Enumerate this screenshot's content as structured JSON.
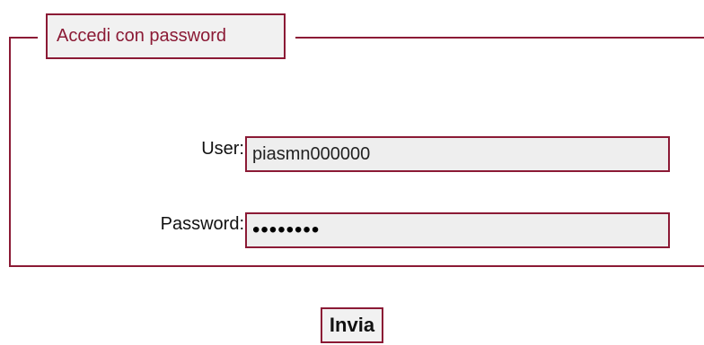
{
  "login_form": {
    "legend": "Accedi con password",
    "user": {
      "label": "User:",
      "value": "piasmn000000"
    },
    "password": {
      "label": "Password:",
      "value": "xxxxxxxx"
    },
    "submit_label": "Invia"
  },
  "colors": {
    "border": "#8b1a35",
    "input_background": "#eeeeee",
    "legend_text": "#8b1a35"
  }
}
